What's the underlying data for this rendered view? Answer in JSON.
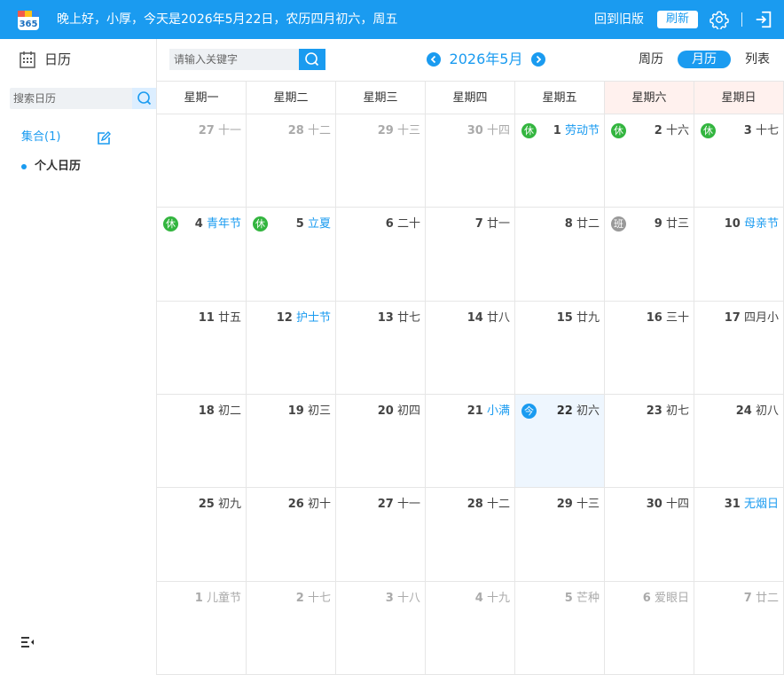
{
  "header": {
    "greeting": "晚上好，小厚，今天是2026年5月22日，农历四月初六，周五",
    "logo_text": "365",
    "old_version": "回到旧版",
    "refresh": "刷新",
    "bg_color": "#1a9bf0"
  },
  "sidebar": {
    "title": "日历",
    "search_placeholder": "搜索日历",
    "collection": "集合(1)",
    "personal": "个人日历"
  },
  "toolbar": {
    "search_placeholder": "请输入关键字",
    "month_label": "2026年5月",
    "views": {
      "week": "周历",
      "month": "月历",
      "list": "列表"
    }
  },
  "calendar": {
    "weekdays": [
      "星期一",
      "星期二",
      "星期三",
      "星期四",
      "星期五",
      "星期六",
      "星期日"
    ],
    "rows": [
      [
        {
          "day": "27",
          "lunar": "十一",
          "other": true
        },
        {
          "day": "28",
          "lunar": "十二",
          "other": true
        },
        {
          "day": "29",
          "lunar": "十三",
          "other": true
        },
        {
          "day": "30",
          "lunar": "十四",
          "other": true
        },
        {
          "day": "1",
          "lunar": "劳动节",
          "festival": true,
          "badge": "休",
          "badge_type": "rest"
        },
        {
          "day": "2",
          "lunar": "十六",
          "badge": "休",
          "badge_type": "rest"
        },
        {
          "day": "3",
          "lunar": "十七",
          "badge": "休",
          "badge_type": "rest"
        }
      ],
      [
        {
          "day": "4",
          "lunar": "青年节",
          "festival": true,
          "badge": "休",
          "badge_type": "rest"
        },
        {
          "day": "5",
          "lunar": "立夏",
          "festival": true,
          "badge": "休",
          "badge_type": "rest"
        },
        {
          "day": "6",
          "lunar": "二十"
        },
        {
          "day": "7",
          "lunar": "廿一"
        },
        {
          "day": "8",
          "lunar": "廿二"
        },
        {
          "day": "9",
          "lunar": "廿三",
          "badge": "班",
          "badge_type": "work"
        },
        {
          "day": "10",
          "lunar": "母亲节",
          "festival": true
        }
      ],
      [
        {
          "day": "11",
          "lunar": "廿五"
        },
        {
          "day": "12",
          "lunar": "护士节",
          "festival": true
        },
        {
          "day": "13",
          "lunar": "廿七"
        },
        {
          "day": "14",
          "lunar": "廿八"
        },
        {
          "day": "15",
          "lunar": "廿九"
        },
        {
          "day": "16",
          "lunar": "三十"
        },
        {
          "day": "17",
          "lunar": "四月小"
        }
      ],
      [
        {
          "day": "18",
          "lunar": "初二"
        },
        {
          "day": "19",
          "lunar": "初三"
        },
        {
          "day": "20",
          "lunar": "初四"
        },
        {
          "day": "21",
          "lunar": "小满",
          "festival": true
        },
        {
          "day": "22",
          "lunar": "初六",
          "today": true,
          "badge": "今",
          "badge_type": "today"
        },
        {
          "day": "23",
          "lunar": "初七"
        },
        {
          "day": "24",
          "lunar": "初八"
        }
      ],
      [
        {
          "day": "25",
          "lunar": "初九"
        },
        {
          "day": "26",
          "lunar": "初十"
        },
        {
          "day": "27",
          "lunar": "十一"
        },
        {
          "day": "28",
          "lunar": "十二"
        },
        {
          "day": "29",
          "lunar": "十三"
        },
        {
          "day": "30",
          "lunar": "十四"
        },
        {
          "day": "31",
          "lunar": "无烟日",
          "festival": true
        }
      ],
      [
        {
          "day": "1",
          "lunar": "儿童节",
          "festival": true,
          "other": true
        },
        {
          "day": "2",
          "lunar": "十七",
          "other": true
        },
        {
          "day": "3",
          "lunar": "十八",
          "other": true
        },
        {
          "day": "4",
          "lunar": "十九",
          "other": true
        },
        {
          "day": "5",
          "lunar": "芒种",
          "festival": true,
          "other": true
        },
        {
          "day": "6",
          "lunar": "爱眼日",
          "festival": true,
          "other": true
        },
        {
          "day": "7",
          "lunar": "廿二",
          "other": true
        }
      ]
    ]
  }
}
